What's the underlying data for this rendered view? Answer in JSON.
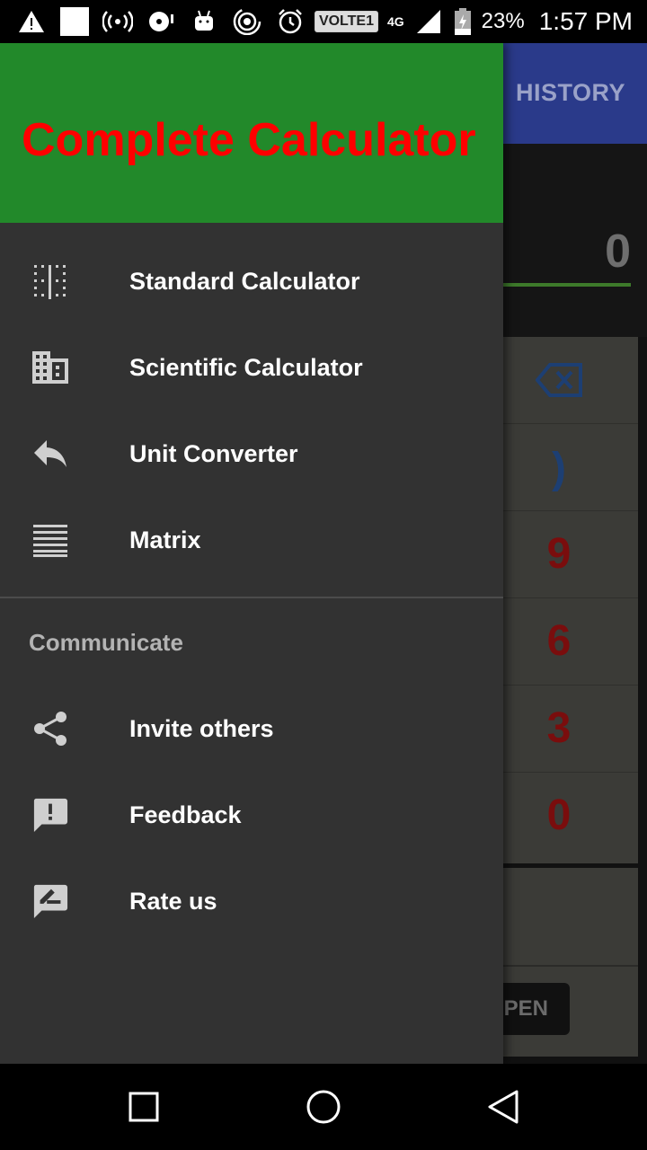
{
  "status_bar": {
    "battery_text": "23%",
    "time": "1:57 PM",
    "network_badge": "VOLTE1",
    "network_type": "4G",
    "icons": [
      "warning-icon",
      "notification-square-icon",
      "hotspot-icon",
      "media-icon",
      "android-icon",
      "wifi-calling-icon",
      "alarm-icon",
      "volte-badge",
      "signal-icon",
      "battery-icon"
    ]
  },
  "app": {
    "history_tab": "HISTORY",
    "display_value": "0",
    "visible_keys": [
      ")",
      "9",
      "6",
      "3",
      "0"
    ],
    "open_button": "PEN"
  },
  "drawer": {
    "title": "Complete Calculator",
    "title_color": "#FF0000",
    "header_color": "#22892A",
    "items": [
      {
        "label": "Standard Calculator",
        "icon": "standard-calculator-icon"
      },
      {
        "label": "Scientific Calculator",
        "icon": "scientific-calculator-icon"
      },
      {
        "label": "Unit Converter",
        "icon": "reply-arrow-icon"
      },
      {
        "label": "Matrix",
        "icon": "matrix-icon"
      }
    ],
    "section_title": "Communicate",
    "section_items": [
      {
        "label": "Invite others",
        "icon": "share-icon"
      },
      {
        "label": "Feedback",
        "icon": "feedback-icon"
      },
      {
        "label": "Rate us",
        "icon": "rate-icon"
      }
    ]
  },
  "nav_bar": {
    "buttons": [
      "recents-square-icon",
      "home-circle-icon",
      "back-triangle-icon"
    ]
  }
}
